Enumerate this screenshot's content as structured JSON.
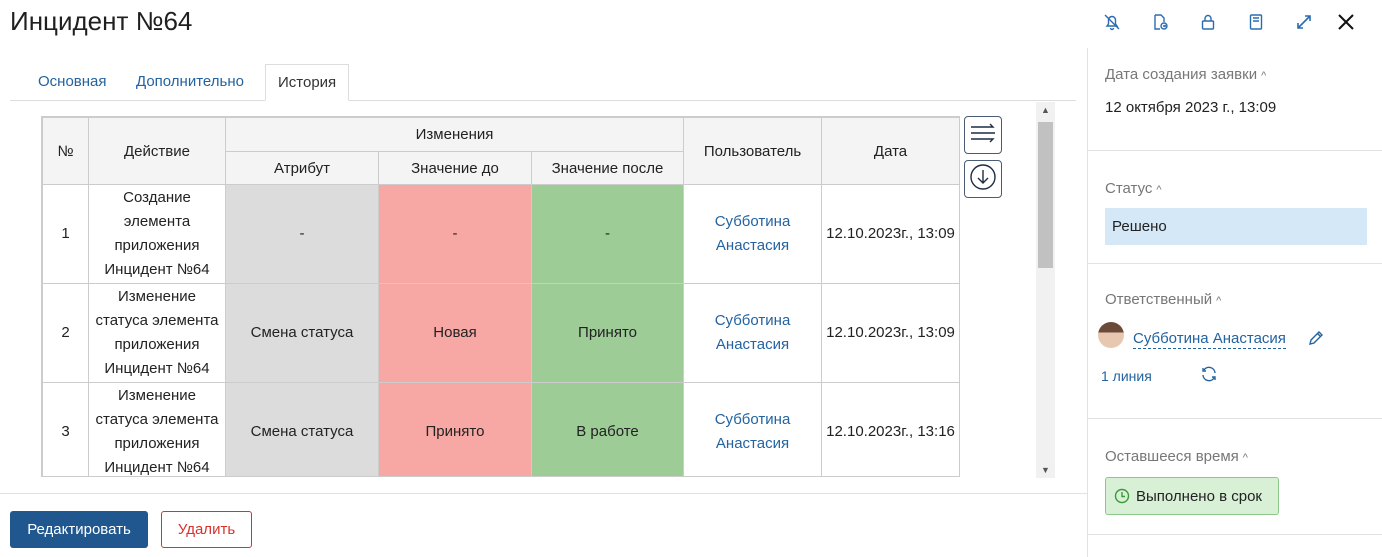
{
  "title": "Инцидент №64",
  "tabs": [
    {
      "label": "Основная"
    },
    {
      "label": "Дополнительно"
    },
    {
      "label": "История"
    }
  ],
  "table": {
    "headers": {
      "num": "№",
      "action": "Действие",
      "changes": "Изменения",
      "attribute": "Атрибут",
      "before": "Значение до",
      "after": "Значение после",
      "user": "Пользователь",
      "date": "Дата"
    },
    "rows": [
      {
        "num": "1",
        "action": "Создание элемента приложения Инцидент №64",
        "attribute": "-",
        "before": "-",
        "after": "-",
        "user": "Субботина Анастасия",
        "date": "12.10.2023г., 13:09"
      },
      {
        "num": "2",
        "action": "Изменение статуса элемента приложения Инцидент №64",
        "attribute": "Смена статуса",
        "before": "Новая",
        "after": "Принято",
        "user": "Субботина Анастасия",
        "date": "12.10.2023г., 13:09"
      },
      {
        "num": "3",
        "action": "Изменение статуса элемента приложения Инцидент №64",
        "attribute": "Смена статуса",
        "before": "Принято",
        "after": "В работе",
        "user": "Субботина Анастасия",
        "date": "12.10.2023г., 13:16"
      }
    ]
  },
  "buttons": {
    "edit": "Редактировать",
    "delete": "Удалить"
  },
  "panel": {
    "created_label": "Дата создания заявки",
    "created_value": "12 октября 2023 г., 13:09",
    "status_label": "Статус",
    "status_value": "Решено",
    "responsible_label": "Ответственный",
    "responsible_value": "Субботина Анастасия",
    "line_value": "1 линия",
    "remaining_label": "Оставшееся время",
    "remaining_value": "Выполнено в срок"
  },
  "colors": {
    "accent": "#21578f",
    "link": "#2363a0",
    "danger": "#d9322b",
    "before_bg": "#f8a8a4",
    "after_bg": "#9dcc97",
    "status_bg": "#d5e8f8"
  },
  "icons": [
    "bell-off-icon",
    "file-export-icon",
    "lock-icon",
    "book-icon",
    "expand-icon",
    "close-icon",
    "columns-settings-icon",
    "download-icon",
    "pencil-icon",
    "refresh-icon",
    "clock-icon"
  ]
}
